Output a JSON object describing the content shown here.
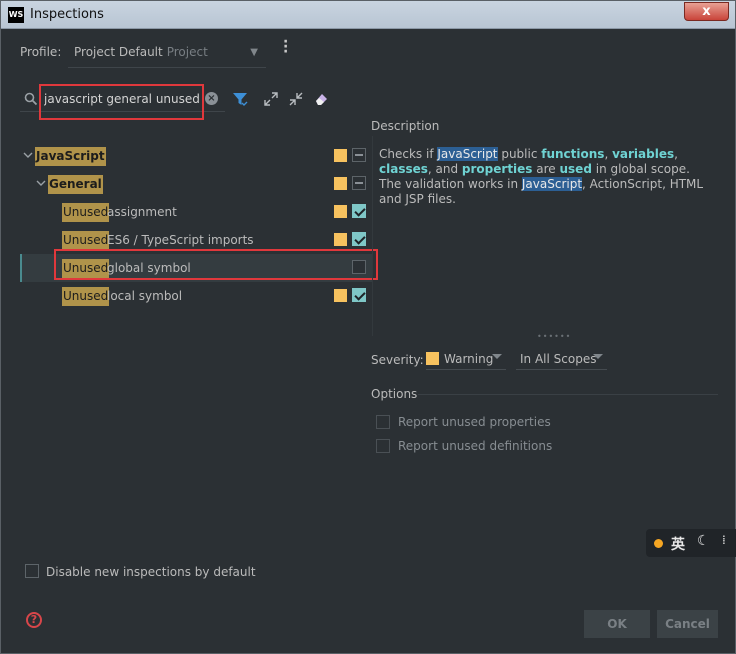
{
  "window": {
    "title": "Inspections",
    "app_icon": "WS",
    "close_label": "x"
  },
  "profile": {
    "label": "Profile:",
    "name": "Project Default",
    "scope": "Project"
  },
  "search": {
    "value": "javascript general unused",
    "clear_icon": "clear-icon"
  },
  "toolbar": {
    "icons": [
      "filter-icon",
      "expand-all-icon",
      "collapse-all-icon",
      "eraser-icon"
    ]
  },
  "tree": {
    "rows": [
      {
        "highlight": "JavaScript",
        "text": "",
        "state": "mixed",
        "severity_color": "#f7c25f",
        "expanded": true
      },
      {
        "highlight": "General",
        "text": "",
        "state": "mixed",
        "severity_color": "#f7c25f",
        "expanded": true
      },
      {
        "highlight": "Unused",
        "text": "assignment",
        "state": "checked",
        "severity_color": "#f7c25f"
      },
      {
        "highlight": "Unused",
        "text": "ES6 / TypeScript imports",
        "state": "checked",
        "severity_color": "#f7c25f"
      },
      {
        "highlight": "Unused",
        "text": "global symbol",
        "state": "unchecked",
        "selected": true
      },
      {
        "highlight": "Unused",
        "text": "local symbol",
        "state": "checked",
        "severity_color": "#f7c25f"
      }
    ]
  },
  "description": {
    "label": "Description",
    "parts": [
      {
        "t": "Checks if ",
        "s": "plain"
      },
      {
        "t": "JavaScript",
        "s": "sel"
      },
      {
        "t": " public ",
        "s": "plain"
      },
      {
        "t": "functions",
        "s": "kw"
      },
      {
        "t": ", ",
        "s": "plain"
      },
      {
        "t": "variables",
        "s": "kw"
      },
      {
        "t": ", ",
        "s": "plain"
      },
      {
        "t": "classes",
        "s": "kw"
      },
      {
        "t": ", and ",
        "s": "plain"
      },
      {
        "t": "properties",
        "s": "kw"
      },
      {
        "t": " are ",
        "s": "plain"
      },
      {
        "t": "used",
        "s": "kw"
      },
      {
        "t": " in global scope. The validation works in ",
        "s": "plain"
      },
      {
        "t": "JavaScript",
        "s": "sel"
      },
      {
        "t": ", ActionScript, HTML and JSP files.",
        "s": "plain"
      }
    ]
  },
  "severity": {
    "label": "Severity:",
    "value": "Warning",
    "color": "#f7c25f",
    "scope": "In All Scopes"
  },
  "options": {
    "label": "Options",
    "items": [
      "Report unused properties",
      "Report unused definitions"
    ]
  },
  "ime": {
    "char": "英"
  },
  "footer": {
    "disable_label": "Disable new inspections by default",
    "help": "?",
    "ok": "OK",
    "cancel": "Cancel"
  }
}
